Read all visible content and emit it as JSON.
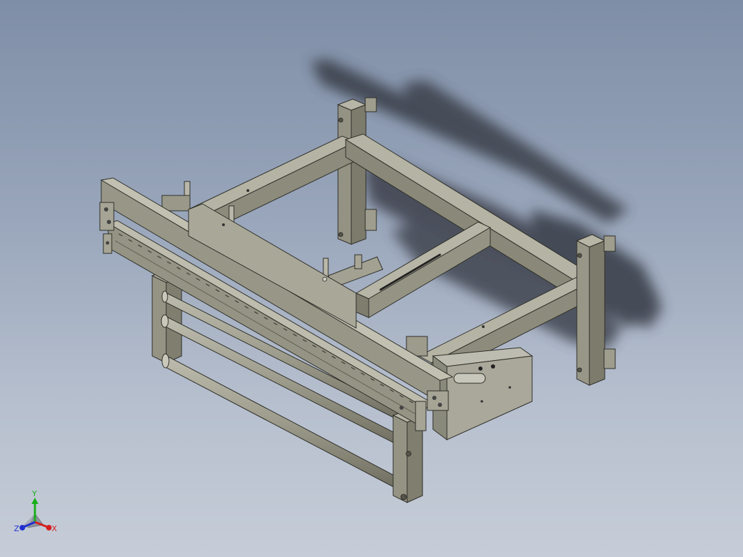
{
  "viewport": {
    "background_top": "#7f8ea7",
    "background_bottom": "#c6cdd8",
    "model_color": "#8f8e7e",
    "shadow_color": "#3a3f48"
  },
  "triad": {
    "x_label": "X",
    "y_label": "Y",
    "z_label": "Z",
    "x_color": "#d42020",
    "y_color": "#18b018",
    "z_color": "#2030d0"
  }
}
